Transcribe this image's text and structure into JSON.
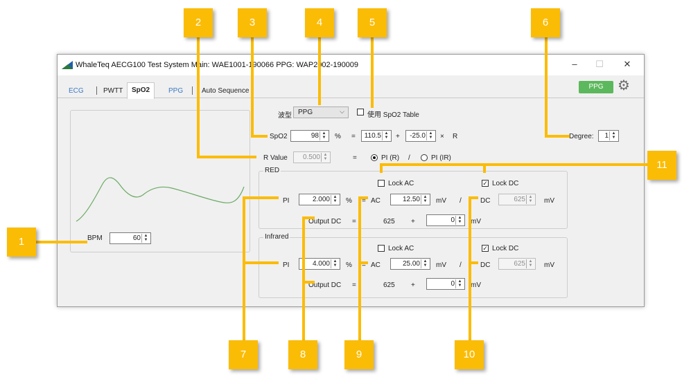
{
  "window": {
    "title": "WhaleTeq AECG100 Test System   Main: WAE1001-190066  PPG: WAP2002-190009",
    "minimize": "–",
    "maximize": "☐",
    "close": "✕"
  },
  "tabs": [
    {
      "label": "ECG",
      "color": "#3b78c4"
    },
    {
      "label": "PWTT",
      "color": "#222222"
    },
    {
      "label": "SpO2",
      "color": "#111111"
    },
    {
      "label": "PPG",
      "color": "#3b78c4"
    },
    {
      "label": "Auto Sequence",
      "color": "#222222"
    }
  ],
  "ppg_badge": "PPG",
  "settings_icon": "gear-icon",
  "waveform": {
    "label": "波型",
    "selected": "PPG"
  },
  "use_table": {
    "label": "使用 SpO2 Table",
    "checked": false
  },
  "spo2": {
    "label": "SpO2",
    "value": "98",
    "unit": "%",
    "eq": "=",
    "a": "110.5",
    "plus": "+",
    "b": "-25.0",
    "times": "×",
    "r": "R"
  },
  "degree": {
    "label": "Degree:",
    "value": "1"
  },
  "rvalue": {
    "label": "R Value",
    "value": "0.500",
    "eq": "=",
    "opt1": "PI (R)",
    "slash": "/",
    "opt2": "PI (IR)"
  },
  "bpm": {
    "label": "BPM",
    "value": "60"
  },
  "red": {
    "title": "RED",
    "lock_ac": "Lock AC",
    "lock_ac_checked": false,
    "lock_dc": "Lock DC",
    "lock_dc_checked": true,
    "pi_label": "PI",
    "pi": "2.000",
    "pct": "%",
    "eq": "=",
    "ac_label": "AC",
    "ac": "12.50",
    "mv": "mV",
    "slash": "/",
    "dc_label": "DC",
    "dc": "625",
    "mv2": "mV",
    "outdc_label": "Output DC",
    "eq2": "=",
    "outdc": "625",
    "plus": "+",
    "offset": "0",
    "mv3": "mV"
  },
  "infrared": {
    "title": "Infrared",
    "lock_ac": "Lock AC",
    "lock_ac_checked": false,
    "lock_dc": "Lock DC",
    "lock_dc_checked": true,
    "pi_label": "PI",
    "pi": "4.000",
    "pct": "%",
    "eq": "=",
    "ac_label": "AC",
    "ac": "25.00",
    "mv": "mV",
    "slash": "/",
    "dc_label": "DC",
    "dc": "625",
    "mv2": "mV",
    "outdc_label": "Output DC",
    "eq2": "=",
    "outdc": "625",
    "plus": "+",
    "offset": "0",
    "mv3": "mV"
  },
  "callouts": [
    "1",
    "2",
    "3",
    "4",
    "5",
    "6",
    "7",
    "8",
    "9",
    "10",
    "11"
  ],
  "colors": {
    "callout": "#fbbc05",
    "ppg_green": "#5cb85c",
    "wave": "#6aaa64"
  }
}
